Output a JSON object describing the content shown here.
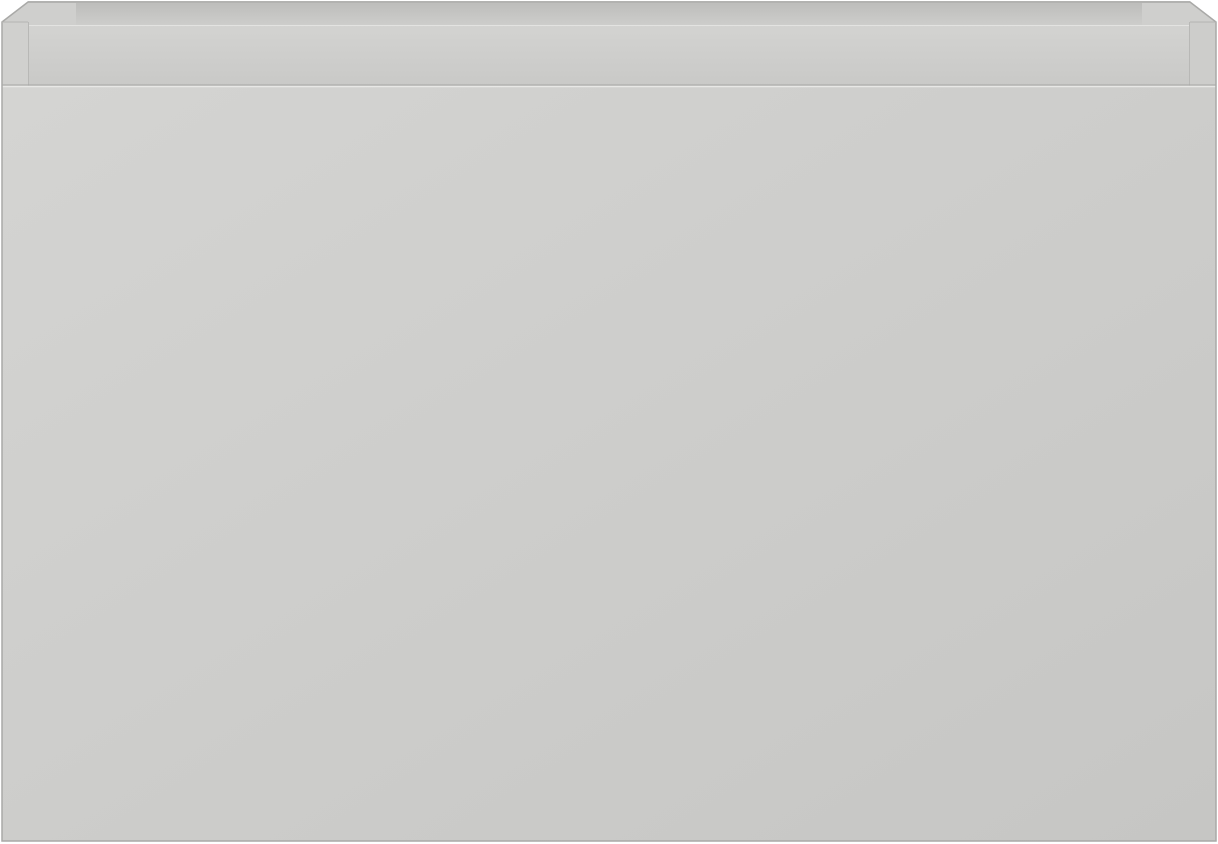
{
  "image": {
    "subject": "",
    "colors": {
      "background": "#ffffff",
      "body_light": "#d4d4d2",
      "body_dark": "#c6c6c4",
      "rim_light": "#d2d2d0",
      "rim_dark": "#c9c9c7",
      "inner_back": "#c8c8c6",
      "edge_shadow": "#a9a9a7",
      "edge_highlight": "#e6e6e4"
    }
  }
}
